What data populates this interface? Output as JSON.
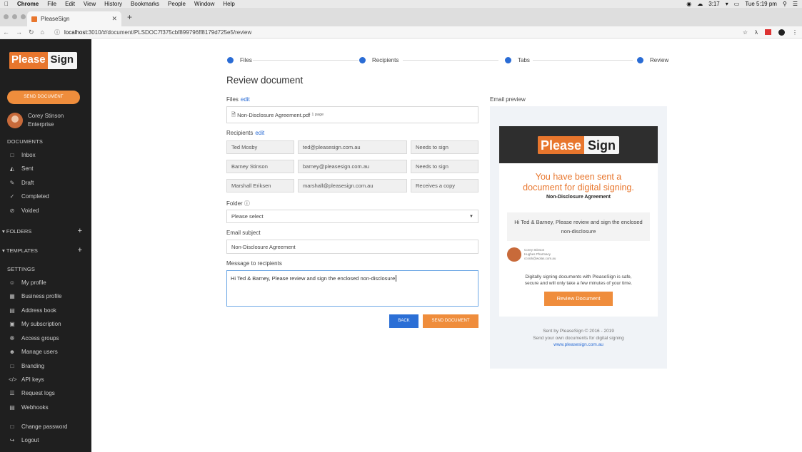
{
  "macos": {
    "app_name": "Chrome",
    "menus": [
      "File",
      "Edit",
      "View",
      "History",
      "Bookmarks",
      "People",
      "Window",
      "Help"
    ],
    "time_short": "3:17",
    "clock": "Tue 5:19 pm"
  },
  "browser": {
    "tab_title": "PleaseSign",
    "url_domain": "localhost",
    "url_path": ":3010/#/document/PLSDOC7f375cbf899796ff8179d725e5/review"
  },
  "sidebar": {
    "logo_please": "Please",
    "logo_sign": "Sign",
    "send_button": "SEND DOCUMENT",
    "user_name": "Corey Stinson",
    "user_plan": "Enterprise",
    "documents_heading": "DOCUMENTS",
    "documents": [
      {
        "label": "Inbox",
        "icon": "inbox-icon"
      },
      {
        "label": "Sent",
        "icon": "sent-icon"
      },
      {
        "label": "Draft",
        "icon": "pencil-icon"
      },
      {
        "label": "Completed",
        "icon": "check-icon"
      },
      {
        "label": "Voided",
        "icon": "void-icon"
      }
    ],
    "folders_label": "FOLDERS",
    "templates_label": "TEMPLATES",
    "settings_heading": "SETTINGS",
    "settings": [
      {
        "label": "My profile",
        "icon": "user-icon"
      },
      {
        "label": "Business profile",
        "icon": "building-icon"
      },
      {
        "label": "Address book",
        "icon": "book-icon"
      },
      {
        "label": "My subscription",
        "icon": "card-icon"
      },
      {
        "label": "Access groups",
        "icon": "group-icon"
      },
      {
        "label": "Manage users",
        "icon": "users-icon"
      },
      {
        "label": "Branding",
        "icon": "brush-icon"
      },
      {
        "label": "API keys",
        "icon": "code-icon"
      },
      {
        "label": "Request logs",
        "icon": "list-icon"
      },
      {
        "label": "Webhooks",
        "icon": "webhook-icon"
      }
    ],
    "change_password": "Change password",
    "logout": "Logout"
  },
  "steps": [
    "Files",
    "Recipients",
    "Tabs",
    "Review"
  ],
  "main": {
    "title": "Review document",
    "files_label": "Files",
    "edit": "edit",
    "file_name": "Non-Disclosure Agreement.pdf",
    "file_pages": "1 page",
    "recipients_label": "Recipients",
    "recipients": [
      {
        "name": "Ted Mosby",
        "email": "ted@pleasesign.com.au",
        "role": "Needs to sign"
      },
      {
        "name": "Barney Stinson",
        "email": "barney@pleasesign.com.au",
        "role": "Needs to sign"
      },
      {
        "name": "Marshall Eriksen",
        "email": "marshall@pleasesign.com.au",
        "role": "Receives a copy"
      }
    ],
    "folder_label": "Folder",
    "folder_placeholder": "Please select",
    "subject_label": "Email subject",
    "subject_value": "Non-Disclosure Agreement",
    "message_label": "Message to recipients",
    "message_value": "Hi Ted & Barney, Please review and sign the enclosed non-disclosure",
    "back_button": "BACK",
    "send_button": "SEND DOCUMENT"
  },
  "preview": {
    "label": "Email preview",
    "headline_line1": "You have been sent a",
    "headline_line2": "document for digital signing.",
    "doc_title": "Non-Disclosure Agreement",
    "message": "Hi Ted & Barney, Please review and sign the enclosed non-disclosure",
    "sender_name": "Corey Stinson",
    "sender_company": "Hughes Pharmacy",
    "sender_email": "ccsick@wolas.com.au",
    "footer_line1": "Digitally signing documents with PleaseSign is safe,",
    "footer_line2": "secure and will only take a few minutes of your time.",
    "review_button": "Review Document",
    "sent_by": "Sent by PleaseSign © 2016 - 2019",
    "send_own": "Send your own documents for digital signing",
    "website": "www.pleasesign.com.au"
  }
}
